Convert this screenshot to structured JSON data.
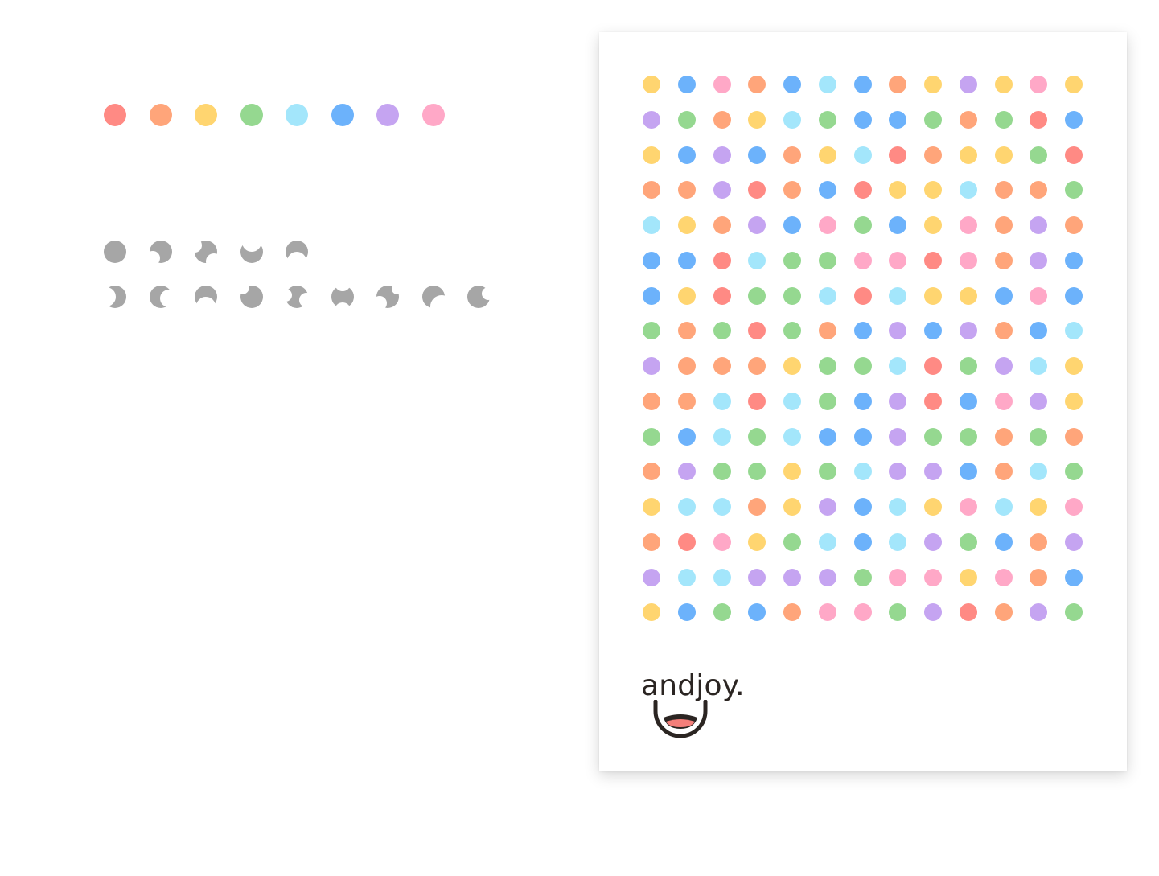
{
  "brand": {
    "name": "andjoy.",
    "text_color": "#2b2522",
    "mouth_color": "#f47f7a"
  },
  "palette": [
    "#ff8a84",
    "#ffa57a",
    "#ffd570",
    "#95d890",
    "#a3e6fb",
    "#6cb2fb",
    "#c5a4f1",
    "#ffa8c7"
  ],
  "shape_color": "#a6a6a6",
  "shape_row_a": [
    "full",
    "bite-bl",
    "bite-tl-br",
    "bite-top",
    "bite-bottom"
  ],
  "shape_row_b": [
    "crescent-right",
    "crescent-left",
    "bite-bottom",
    "bite-top-left",
    "bite-left-right",
    "bite-top-bottom",
    "bite-top-right",
    "bite-right",
    "bite-right-top"
  ],
  "poster": {
    "cols": 13,
    "rows": 16,
    "dot_colors": [
      "Y",
      "B",
      "P",
      "O",
      "B",
      "C",
      "B",
      "O",
      "Y",
      "V",
      "Y",
      "P",
      "Y",
      "V",
      "G",
      "O",
      "Y",
      "C",
      "G",
      "B",
      "B",
      "G",
      "O",
      "G",
      "R",
      "B",
      "Y",
      "B",
      "V",
      "B",
      "O",
      "Y",
      "C",
      "R",
      "O",
      "Y",
      "Y",
      "G",
      "R",
      "O",
      "O",
      "V",
      "R",
      "O",
      "B",
      "R",
      "Y",
      "Y",
      "C",
      "O",
      "O",
      "G",
      "C",
      "Y",
      "O",
      "V",
      "B",
      "P",
      "G",
      "B",
      "Y",
      "P",
      "O",
      "V",
      "O",
      "B",
      "B",
      "R",
      "C",
      "G",
      "G",
      "P",
      "P",
      "R",
      "P",
      "O",
      "V",
      "B",
      "B",
      "Y",
      "R",
      "G",
      "G",
      "C",
      "R",
      "C",
      "Y",
      "Y",
      "B",
      "P",
      "B",
      "G",
      "O",
      "G",
      "R",
      "G",
      "O",
      "B",
      "V",
      "B",
      "V",
      "O",
      "B",
      "C",
      "V",
      "O",
      "O",
      "O",
      "Y",
      "G",
      "G",
      "C",
      "R",
      "G",
      "V",
      "C",
      "Y",
      "O",
      "O",
      "C",
      "R",
      "C",
      "G",
      "B",
      "V",
      "R",
      "B",
      "P",
      "V",
      "Y",
      "G",
      "B",
      "C",
      "G",
      "C",
      "B",
      "B",
      "V",
      "G",
      "G",
      "O",
      "G",
      "O",
      "O",
      "V",
      "G",
      "G",
      "Y",
      "G",
      "C",
      "V",
      "V",
      "B",
      "O",
      "C",
      "G",
      "Y",
      "C",
      "C",
      "O",
      "Y",
      "V",
      "B",
      "C",
      "Y",
      "P",
      "C",
      "Y",
      "P",
      "O",
      "R",
      "P",
      "Y",
      "G",
      "C",
      "B",
      "C",
      "V",
      "G",
      "B",
      "O",
      "V",
      "V",
      "C",
      "C",
      "V",
      "V",
      "V",
      "G",
      "P",
      "P",
      "Y",
      "P",
      "O",
      "B",
      "Y",
      "B",
      "G",
      "B",
      "O",
      "P",
      "P",
      "G",
      "V",
      "R",
      "O",
      "V",
      "G"
    ],
    "color_key": {
      "R": "#ff8a84",
      "O": "#ffa57a",
      "Y": "#ffd570",
      "G": "#95d890",
      "C": "#a3e6fb",
      "B": "#6cb2fb",
      "V": "#c5a4f1",
      "P": "#ffa8c7"
    }
  }
}
